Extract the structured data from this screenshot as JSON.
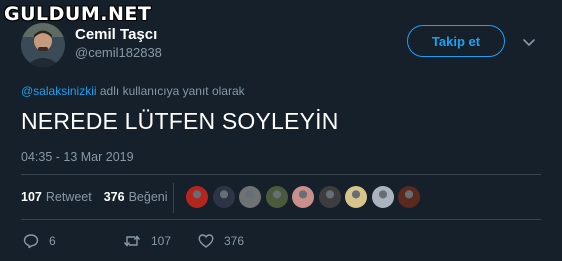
{
  "watermark": {
    "text": "GULDUM.NET"
  },
  "author": {
    "display_name": "Cemil Taşcı",
    "handle": "@cemil182838",
    "avatar_icon": "profile-avatar"
  },
  "follow_button": {
    "label": "Takip et"
  },
  "menu": {
    "icon": "chevron-down-icon"
  },
  "reply_context": {
    "mention": "@salaksinizkii",
    "suffix": " adlı kullanıcıya yanıt olarak"
  },
  "tweet": {
    "text": "NEREDE LÜTFEN SOYLEYİN",
    "timestamp": "04:35 - 13 Mar 2019"
  },
  "stats": {
    "retweets_count": "107",
    "retweets_label": "Retweet",
    "likes_count": "376",
    "likes_label": "Beğeni"
  },
  "likers": [
    {
      "name": "liker-avatar-1",
      "color": "#b3261e"
    },
    {
      "name": "liker-avatar-2",
      "color": "#2c3446"
    },
    {
      "name": "liker-avatar-3",
      "color": "#6f7272"
    },
    {
      "name": "liker-avatar-4",
      "color": "#4a5a3a"
    },
    {
      "name": "liker-avatar-5",
      "color": "#c98f8a"
    },
    {
      "name": "liker-avatar-6",
      "color": "#3d3d3d"
    },
    {
      "name": "liker-avatar-7",
      "color": "#d7c48a"
    },
    {
      "name": "liker-avatar-8",
      "color": "#aab4bf"
    },
    {
      "name": "liker-avatar-9",
      "color": "#5a2a1e"
    }
  ],
  "actions": {
    "reply_count": "6",
    "retweet_count": "107",
    "like_count": "376"
  },
  "colors": {
    "background": "#15202b",
    "accent": "#1da1f2",
    "muted": "#8899a6",
    "divider": "#38444d"
  }
}
